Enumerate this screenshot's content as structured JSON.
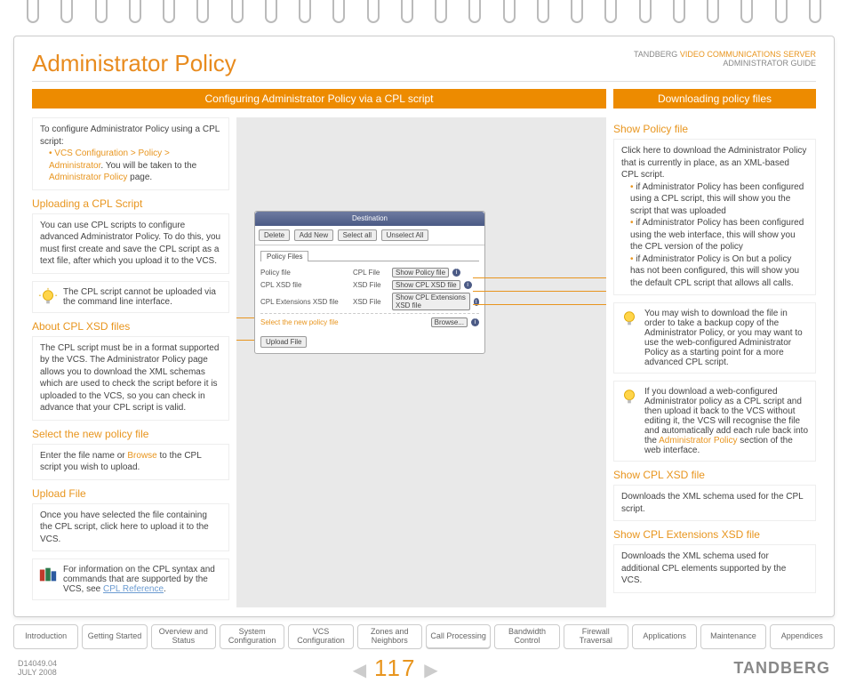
{
  "title": "Administrator Policy",
  "top_right": {
    "a": "TANDBERG ",
    "b": "VIDEO COMMUNICATIONS SERVER",
    "c": "ADMINISTRATOR GUIDE"
  },
  "bands": {
    "left": "Configuring Administrator Policy via a CPL script",
    "right": "Downloading policy files"
  },
  "box_intro": {
    "lead": "To configure Administrator Policy using a CPL script:",
    "path": "VCS Configuration > Policy > Administrator",
    "after": ". You will be taken to the ",
    "link": "Administrator Policy",
    "end": " page."
  },
  "uploading": {
    "h": "Uploading a CPL Script",
    "p": "You can use CPL scripts to configure advanced Administrator Policy.  To do this, you must first create and save the CPL script as a text file, after which you upload it to the VCS."
  },
  "note1": "The CPL script cannot be uploaded via the command line interface.",
  "about": {
    "h": "About CPL XSD files",
    "p": "The CPL script must be in a format supported by the VCS.  The Administrator Policy page allows you to download the XML schemas which are used to check the script before it is uploaded to the VCS, so you can check in advance that your CPL script is valid."
  },
  "select": {
    "h": "Select the new policy file",
    "p1": "Enter the file name or ",
    "browse": "Browse",
    "p2": " to the CPL script you wish to upload."
  },
  "upload": {
    "h": "Upload File",
    "p": "Once you have selected the file containing the CPL script, click here to upload it to the VCS."
  },
  "note2": {
    "p1": "For information on the CPL syntax and commands that are supported by the VCS, see ",
    "link": "CPL Reference",
    "p2": "."
  },
  "right": {
    "show": {
      "h": "Show Policy file",
      "p": "Click here to download the Administrator Policy that is currently in place, as an XML-based CPL script.",
      "li1": "if Administrator Policy has been configured using a CPL script, this will show you the script that was uploaded",
      "li2": "if Administrator Policy has been configured using the web interface, this will show you the CPL version of the policy",
      "li3": "if Administrator Policy is On but a policy has not been configured, this  will show you the default CPL script that allows all calls."
    },
    "note3": "You may wish to download the file in order to take a backup copy of the Administrator Policy, or you may want to use the web-configured Administrator Policy as a starting point for a more advanced CPL script.",
    "note4": {
      "p1": "If you download a web-configured Administrator policy as a CPL script and then upload it back to the VCS without editing it, the VCS will recognise the file and automatically add each rule back into the ",
      "link": "Administrator Policy",
      "p2": " section of the web interface."
    },
    "xsd": {
      "h": "Show CPL XSD file",
      "p": "Downloads the XML schema used for the CPL script."
    },
    "ext": {
      "h": "Show CPL Extensions XSD file",
      "p": "Downloads the XML schema used for additional CPL elements supported by the VCS."
    }
  },
  "mock": {
    "bar": "Destination",
    "toolbar": [
      "Delete",
      "Add New",
      "Select all",
      "Unselect All"
    ],
    "tab": "Policy Files",
    "rows": [
      {
        "l": "Policy file",
        "m": "CPL File",
        "b": "Show Policy file"
      },
      {
        "l": "CPL XSD file",
        "m": "XSD File",
        "b": "Show CPL XSD file"
      },
      {
        "l": "CPL Extensions XSD file",
        "m": "XSD File",
        "b": "Show CPL Extensions XSD file"
      }
    ],
    "sel": "Select the new policy file",
    "browse": "Browse...",
    "upload": "Upload File"
  },
  "nav": [
    "Introduction",
    "Getting Started",
    "Overview and Status",
    "System Configuration",
    "VCS Configuration",
    "Zones and Neighbors",
    "Call Processing",
    "Bandwidth Control",
    "Firewall Traversal",
    "Applications",
    "Maintenance",
    "Appendices"
  ],
  "footer": {
    "id": "D14049.04",
    "date": "JULY 2008",
    "page": "117",
    "brand": "TANDBERG"
  }
}
